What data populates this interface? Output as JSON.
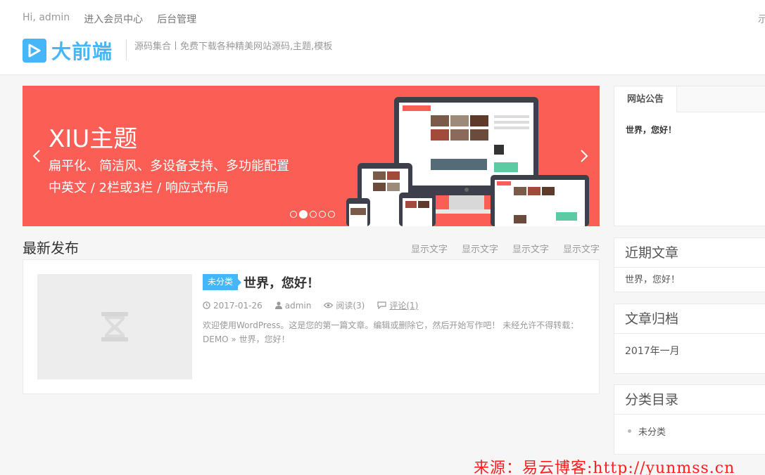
{
  "topnav": {
    "greeting": "Hi, admin",
    "member_center": "进入会员中心",
    "admin_panel": "后台管理",
    "right_partial": "示"
  },
  "logo": {
    "text": "大前端",
    "tagline": "源码集合丨免费下载各种精美网站源码,主题,模板"
  },
  "slider": {
    "title": "XIU主题",
    "line1": "扁平化、简洁风、多设备支持、多功能配置",
    "line2": "中英文 / 2栏或3栏 / 响应式布局",
    "dot_count": 5,
    "active_dot": 1
  },
  "latest": {
    "title": "最新发布",
    "links": [
      "显示文字",
      "显示文字",
      "显示文字",
      "显示文字"
    ]
  },
  "post": {
    "category": "未分类",
    "title": "世界，您好！",
    "date": "2017-01-26",
    "author": "admin",
    "views": "阅读(3)",
    "comments": "评论(1)",
    "excerpt": "欢迎使用WordPress。这是您的第一篇文章。编辑或删除它，然后开始写作吧！ 未经允许不得转载：DEMO » 世界，您好！"
  },
  "sidebar": {
    "notice_tab": "网站公告",
    "notice_body": "世界，您好！",
    "recent_title": "近期文章",
    "recent_item": "世界，您好！",
    "archive_title": "文章归档",
    "archive_item": "2017年一月",
    "cats_title": "分类目录",
    "cats_item": "未分类"
  },
  "watermark": "来源：易云博客:http://yunmss.cn",
  "colors": {
    "accent": "#45b6f7",
    "slider_bg": "#fb5e55",
    "watermark": "#ff1e1e"
  }
}
